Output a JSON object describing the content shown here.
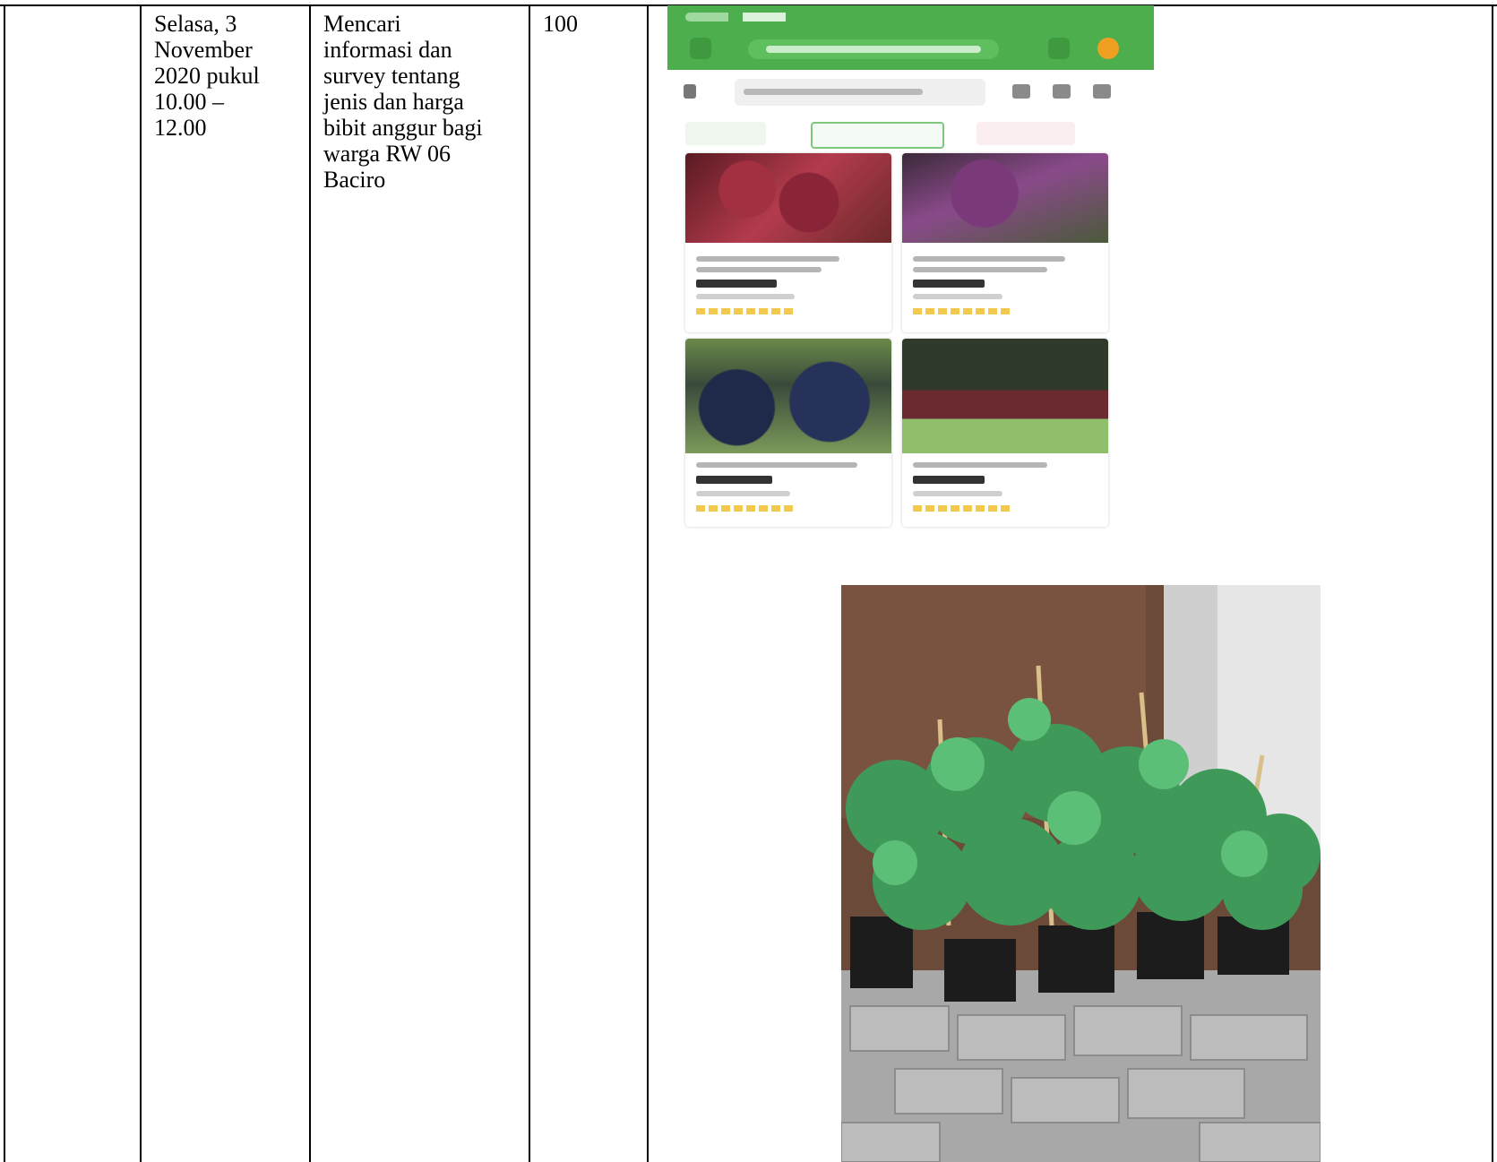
{
  "table": {
    "row": {
      "date_time": "Selasa, 3\nNovember\n2020 pukul\n10.00 –\n12.00",
      "activity": "Mencari\ninformasi dan\nsurvey tentang\njenis dan harga\nbibit anggur bagi\nwarga RW 06\nBaciro",
      "percentage": "100"
    }
  },
  "images": {
    "screenshot": "marketplace-search-screenshot",
    "photo": "grape-seedlings-photo"
  },
  "colors": {
    "app_green": "#4cae4c",
    "border": "#000000"
  }
}
